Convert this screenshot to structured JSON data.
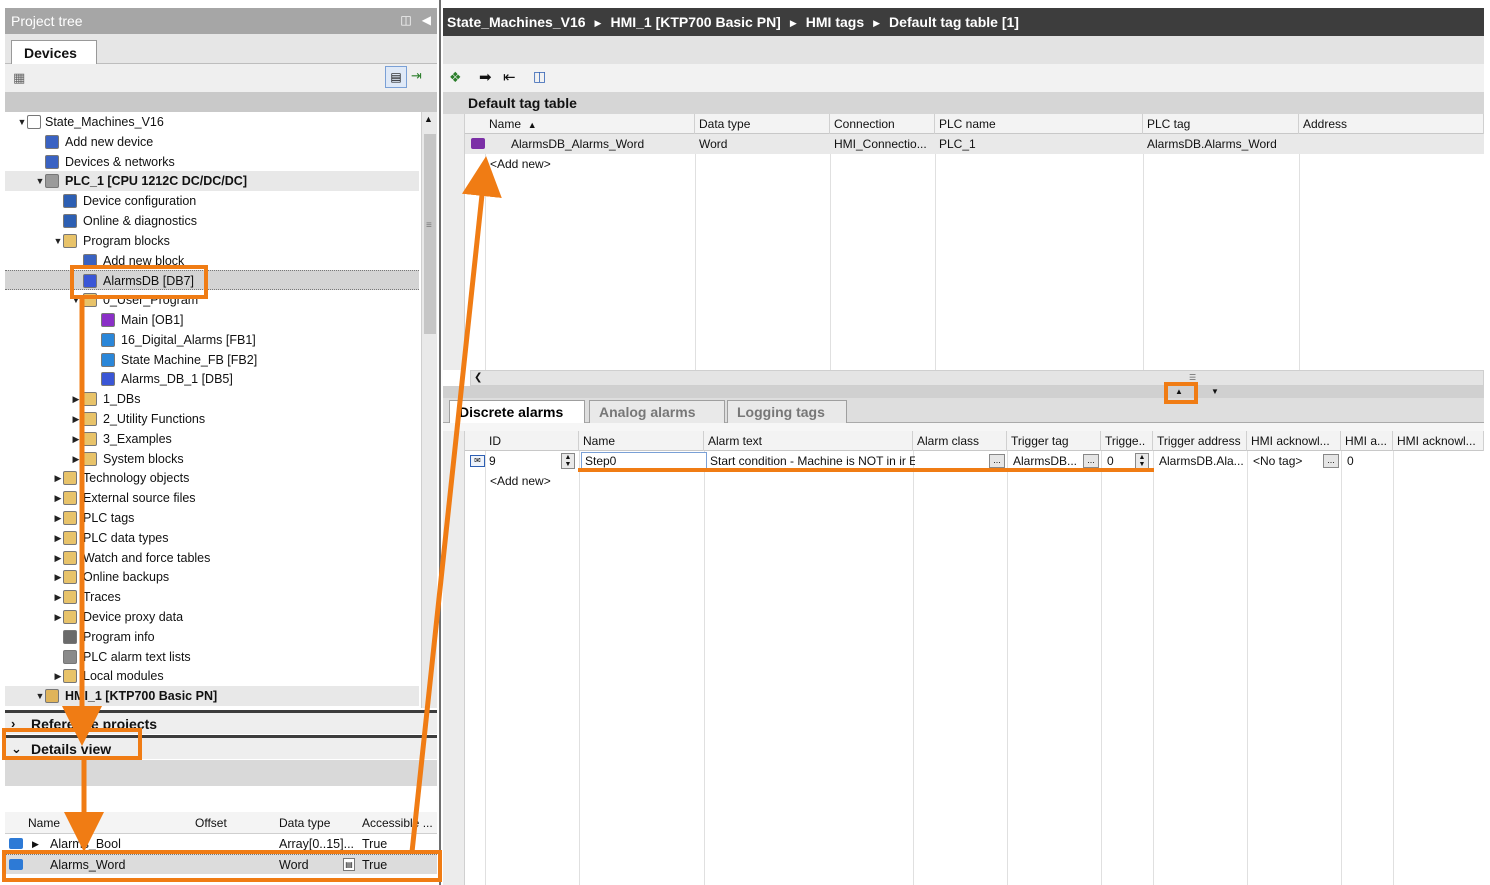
{
  "project_tree": {
    "title": "Project tree",
    "tab": "Devices",
    "items": [
      {
        "label": "State_Machines_V16",
        "icon": "project-icon"
      },
      {
        "label": "Add new device",
        "icon": "add-device-icon"
      },
      {
        "label": "Devices & networks",
        "icon": "network-icon"
      },
      {
        "label": "PLC_1 [CPU 1212C DC/DC/DC]",
        "icon": "plc-icon"
      },
      {
        "label": "Device configuration",
        "icon": "device-config-icon"
      },
      {
        "label": "Online & diagnostics",
        "icon": "diagnostics-icon"
      },
      {
        "label": "Program blocks",
        "icon": "folder-icon"
      },
      {
        "label": "Add new block",
        "icon": "add-block-icon"
      },
      {
        "label": "AlarmsDB [DB7]",
        "icon": "db-icon"
      },
      {
        "label": "0_User_Program",
        "icon": "folder-icon"
      },
      {
        "label": "Main [OB1]",
        "icon": "ob-icon"
      },
      {
        "label": "16_Digital_Alarms [FB1]",
        "icon": "fb-icon"
      },
      {
        "label": "State Machine_FB [FB2]",
        "icon": "fb-icon"
      },
      {
        "label": "Alarms_DB_1 [DB5]",
        "icon": "db-icon"
      },
      {
        "label": "1_DBs",
        "icon": "folder-icon"
      },
      {
        "label": "2_Utility Functions",
        "icon": "folder-icon"
      },
      {
        "label": "3_Examples",
        "icon": "folder-icon"
      },
      {
        "label": "System blocks",
        "icon": "folder-icon"
      },
      {
        "label": "Technology objects",
        "icon": "folder-icon"
      },
      {
        "label": "External source files",
        "icon": "folder-icon"
      },
      {
        "label": "PLC tags",
        "icon": "folder-icon"
      },
      {
        "label": "PLC data types",
        "icon": "folder-icon"
      },
      {
        "label": "Watch and force tables",
        "icon": "folder-icon"
      },
      {
        "label": "Online backups",
        "icon": "folder-icon"
      },
      {
        "label": "Traces",
        "icon": "folder-icon"
      },
      {
        "label": "Device proxy data",
        "icon": "folder-icon"
      },
      {
        "label": "Program info",
        "icon": "program-info-icon"
      },
      {
        "label": "PLC alarm text lists",
        "icon": "text-list-icon"
      },
      {
        "label": "Local modules",
        "icon": "folder-icon"
      },
      {
        "label": "HMI_1 [KTP700 Basic PN]",
        "icon": "hmi-icon"
      }
    ]
  },
  "reference_projects": "Reference projects",
  "details_view": {
    "title": "Details view",
    "columns": [
      "Name",
      "Offset",
      "Data type",
      "Accessible ..."
    ],
    "rows": [
      {
        "name": "Alarms_Bool",
        "offset": "",
        "type": "Array[0..15]...",
        "accessible": "True"
      },
      {
        "name": "Alarms_Word",
        "offset": "",
        "type": "Word",
        "accessible": "True"
      }
    ]
  },
  "breadcrumb": [
    "State_Machines_V16",
    "HMI_1 [KTP700 Basic PN]",
    "HMI tags",
    "Default tag table [1]"
  ],
  "tag_table": {
    "title": "Default tag table",
    "columns": [
      "Name",
      "Data type",
      "Connection",
      "PLC name",
      "PLC tag",
      "Address"
    ],
    "sort_indicator": "▲",
    "rows": [
      {
        "name": "AlarmsDB_Alarms_Word",
        "type": "Word",
        "connection": "HMI_Connectio...",
        "plc_name": "PLC_1",
        "plc_tag": "AlarmsDB.Alarms_Word",
        "address": ""
      }
    ],
    "add_new": "<Add new>"
  },
  "alarm_tabs": [
    "Discrete alarms",
    "Analog alarms",
    "Logging tags"
  ],
  "alarms": {
    "columns": [
      "ID",
      "Name",
      "Alarm text",
      "Alarm class",
      "Trigger tag",
      "Trigge..",
      "Trigger address",
      "HMI acknowl...",
      "HMI a...",
      "HMI acknowl..."
    ],
    "rows": [
      {
        "id": "9",
        "name": "Step0",
        "text": "Start condition - Machine is NOT in ir Errors",
        "class": "",
        "trigger_tag": "AlarmsDB...",
        "trigger_bit": "0",
        "trigger_address": "AlarmsDB.Ala...",
        "ack_tag": "<No tag>",
        "ack_bit": "0",
        "ack_addr": ""
      }
    ],
    "add_new": "<Add new>"
  },
  "accent_color": "#f07c14"
}
